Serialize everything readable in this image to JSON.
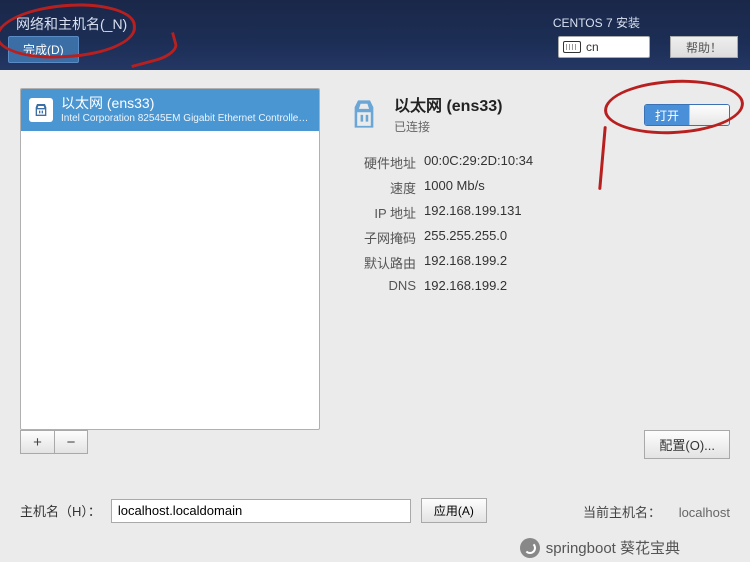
{
  "header": {
    "title": "网络和主机名(_N)",
    "done_btn": "完成(D)",
    "install_label": "CENTOS 7 安装",
    "keyboard": "cn",
    "help_btn": "帮助！"
  },
  "interfaces": {
    "items": [
      {
        "name": "以太网 (ens33)",
        "vendor": "Intel Corporation 82545EM Gigabit Ethernet Controller (…"
      }
    ]
  },
  "detail": {
    "title": "以太网 (ens33)",
    "status": "已连接",
    "rows": {
      "hwaddr_label": "硬件地址",
      "hwaddr": "00:0C:29:2D:10:34",
      "speed_label": "速度",
      "speed": "1000 Mb/s",
      "ip_label": "IP 地址",
      "ip": "192.168.199.131",
      "mask_label": "子网掩码",
      "mask": "255.255.255.0",
      "gw_label": "默认路由",
      "gw": "192.168.199.2",
      "dns_label": "DNS",
      "dns": "192.168.199.2"
    }
  },
  "toggle": {
    "on_label": "打开"
  },
  "buttons": {
    "plus": "+",
    "minus": "−",
    "configure": "配置(O)...",
    "apply": "应用(A)"
  },
  "hostname": {
    "label": "主机名（H）：",
    "value": "localhost.localdomain",
    "current_label": "当前主机名：",
    "current_value": "localhost"
  },
  "footer": {
    "text": "springboot 葵花宝典"
  }
}
